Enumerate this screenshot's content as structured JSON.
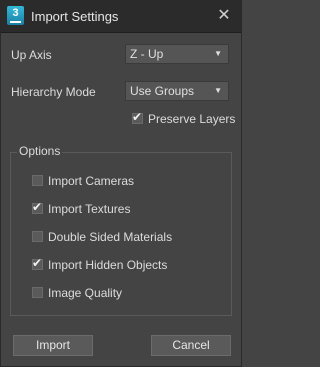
{
  "window": {
    "title": "Import Settings",
    "app_icon_number": "3",
    "close_glyph": "✕"
  },
  "up_axis": {
    "label": "Up Axis",
    "value": "Z - Up"
  },
  "hierarchy_mode": {
    "label": "Hierarchy Mode",
    "value": "Use Groups"
  },
  "preserve_layers": {
    "label": "Preserve Layers",
    "checked": true
  },
  "options": {
    "title": "Options",
    "items": [
      {
        "label": "Import Cameras",
        "checked": false
      },
      {
        "label": "Import Textures",
        "checked": true
      },
      {
        "label": "Double Sided Materials",
        "checked": false
      },
      {
        "label": "Import Hidden Objects",
        "checked": true
      },
      {
        "label": "Image Quality",
        "checked": false
      }
    ]
  },
  "buttons": {
    "import_label": "Import",
    "cancel_label": "Cancel"
  },
  "icons": {
    "app": "3ds-max-app-icon",
    "close": "close-icon",
    "dropdown": "chevron-down-icon",
    "check": "checkmark-icon"
  },
  "colors": {
    "background": "#444444",
    "titlebar": "#2b2b2b",
    "accent_icon": "#1a7fa5"
  }
}
